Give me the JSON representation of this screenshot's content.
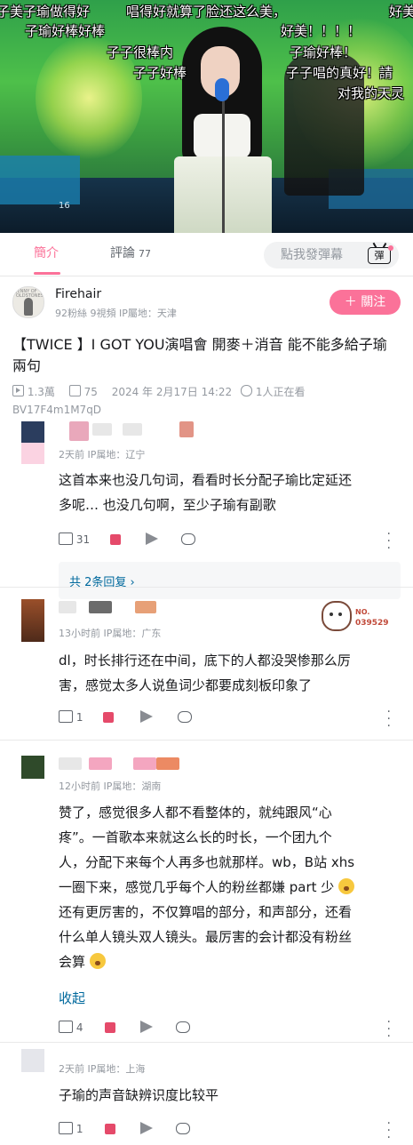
{
  "video": {
    "stage_number": "16",
    "danmaku": [
      "子美子瑜做得好",
      "唱得好就算了脸还这么美，",
      "好美",
      "子瑜好棒好棒",
      "好美！！！！",
      "子子很棒内",
      "子瑜好棒！",
      "子子好棒",
      "子子唱的真好！請",
      "对我的天灵"
    ]
  },
  "tabs": {
    "intro": "簡介",
    "comments": "評論",
    "comments_count": "77",
    "danmaku_placeholder": "點我發彈幕",
    "danmaku_toggle": "彈"
  },
  "uploader": {
    "name": "Firehair",
    "avatar_text": "JENNY OF OLDSTONES",
    "fans": "92粉絲",
    "videos": "9視頻",
    "ip": "IP屬地：天津",
    "follow_label": "＋ 關注"
  },
  "video_info": {
    "title": "【TWICE 】I GOT YOU演唱會 開麥＋消音 能不能多給子瑜兩句",
    "views": "1.3萬",
    "danmaku_count": "75",
    "date": "2024 年 2月17日 14:22",
    "watching": "1人正在看",
    "bvid": "BV17F4m1M7qD"
  },
  "comments": [
    {
      "meta": "2天前 IP属地：辽宁",
      "lines": [
        "这首本来也没几句词，看看时长分配子瑜比定延还",
        "多呢…      也没几句啊，至少子瑜有副歌"
      ],
      "likes": "31",
      "replies_label": "共 2条回复 ›"
    },
    {
      "meta": "13小时前 IP属地：广东",
      "badge_label": "NO.",
      "badge_number": "039529",
      "lines": [
        "dl，时长排行还在中间，底下的人都没哭惨那么厉",
        "害，感觉太多人说鱼词少都要成刻板印象了"
      ],
      "likes": "1"
    },
    {
      "meta": "12小时前 IP属地：湖南",
      "lines": [
        "赞了，感觉很多人都不看整体的，就纯跟风“心",
        "疼”。一首歌本来就这么长的时长，一个团九个",
        "人，分配下来每个人再多也就那样。wb，B站 xhs",
        "一圈下来，感觉几乎每个人的粉丝都嫌 part 少",
        "还有更厉害的，不仅算唱的部分，和声部分，还看",
        "什么单人镜头双人镜头。最厉害的会计都没有粉丝",
        "会算"
      ],
      "collapse_label": "收起",
      "likes": "4"
    },
    {
      "meta": "2天前 IP属地：上海",
      "lines": [
        "子瑜的声音缺辨识度比较平"
      ],
      "likes": "1"
    }
  ],
  "colors": {
    "accent": "#fb7299",
    "link": "#00699d",
    "dislike": "#e54a6a"
  }
}
